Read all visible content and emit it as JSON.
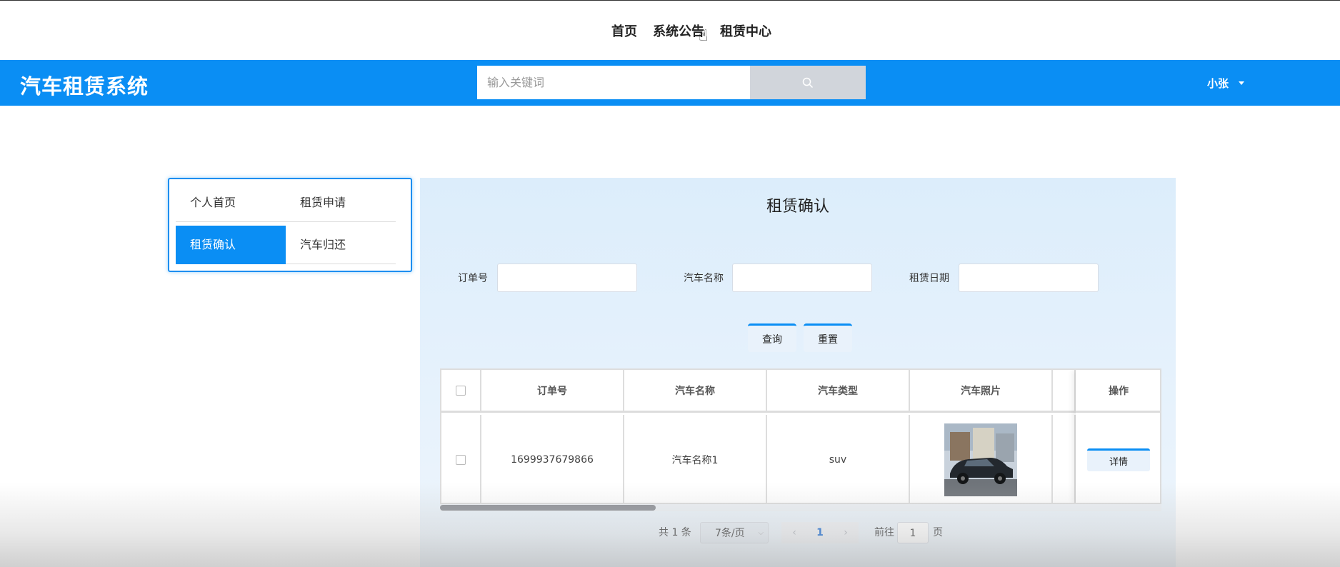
{
  "topnav": {
    "items": [
      "首页",
      "系统公告",
      "租赁中心"
    ]
  },
  "header": {
    "brand": "汽车租赁系统",
    "search_placeholder": "输入关键词",
    "search_icon": "search-icon",
    "user": "小张",
    "user_icon": "caret-down-icon",
    "accent_color": "#0a8ef4"
  },
  "sidebar": {
    "items": [
      {
        "label": "个人首页",
        "active": false
      },
      {
        "label": "租赁申请",
        "active": false
      },
      {
        "label": "租赁确认",
        "active": true
      },
      {
        "label": "汽车归还",
        "active": false
      }
    ]
  },
  "main": {
    "title": "租赁确认",
    "filters": {
      "order_label": "订单号",
      "car_name_label": "汽车名称",
      "date_label": "租赁日期"
    },
    "buttons": {
      "query": "查询",
      "reset": "重置"
    },
    "table": {
      "headers": [
        "订单号",
        "汽车名称",
        "汽车类型",
        "汽车照片",
        "操作"
      ],
      "rows": [
        {
          "order_no": "1699937679866",
          "car_name": "汽车名称1",
          "car_type": "suv",
          "action": "详情"
        }
      ]
    },
    "pagination": {
      "total": "共 1 条",
      "page_size": "7条/页",
      "current_page": "1",
      "goto_label": "前往",
      "goto_value": "1",
      "page_suffix": "页",
      "prev_icon": "chevron-left-icon",
      "next_icon": "chevron-right-icon"
    }
  }
}
